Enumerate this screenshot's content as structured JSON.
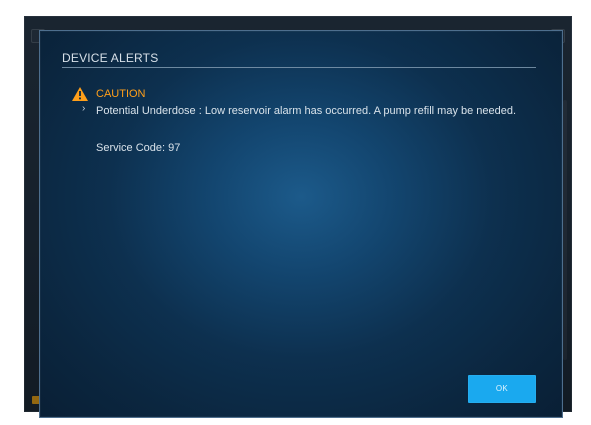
{
  "dialog": {
    "title": "DEVICE ALERTS",
    "alert": {
      "level": "CAUTION",
      "message": "Potential Underdose : Low reservoir alarm has occurred. A pump refill may be needed.",
      "service_code": "Service Code: 97"
    },
    "ok_label": "OK"
  },
  "icons": {
    "warning": "warning-triangle-icon",
    "chevron": "chevron-right-icon"
  },
  "colors": {
    "caution": "#ff9f1a",
    "primary_button": "#1aa9ef"
  }
}
